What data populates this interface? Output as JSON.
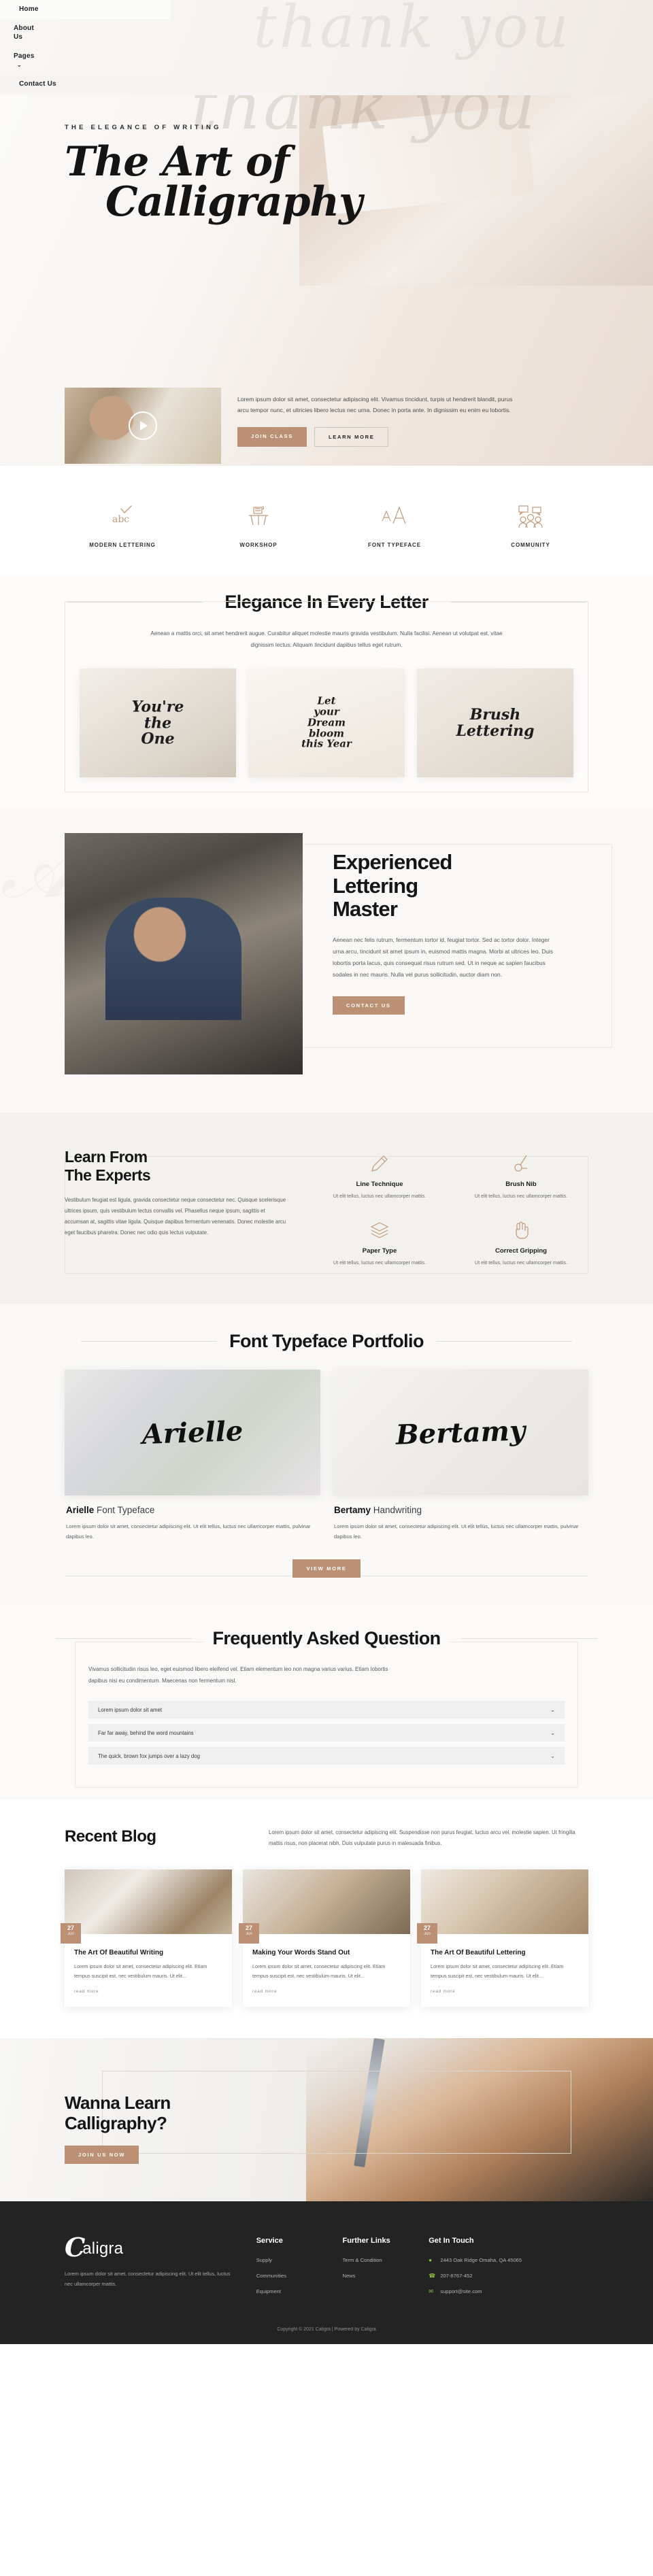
{
  "nav": {
    "items": [
      {
        "label": "Home",
        "caret": false
      },
      {
        "label": "About Us",
        "caret": false
      },
      {
        "label": "Pages",
        "caret": true
      },
      {
        "label": "Contact Us",
        "caret": false
      }
    ],
    "caret_glyph": "⌄"
  },
  "hero": {
    "eyebrow": "THE ELEGANCE OF WRITING",
    "title_line1": "The Art of",
    "title_line2": "Calligraphy",
    "bg_script": "thank you",
    "card": {
      "paragraph": "Lorem ipsum dolor sit amet, consectetur adipiscing elit. Vivamus tincidunt, turpis ut hendrerit blandit, purus arcu tempor nunc, et ultricies libero lectus nec urna. Donec in porta ante. In dignissim eu enim eu lobortis.",
      "primary_button": "JOIN CLASS",
      "secondary_button": "LEARN MORE",
      "play_icon": "play-icon"
    }
  },
  "features": [
    {
      "label": "MODERN LETTERING",
      "icon": "abc-check-icon"
    },
    {
      "label": "WORKSHOP",
      "icon": "workshop-desk-icon"
    },
    {
      "label": "FONT TYPEFACE",
      "icon": "font-aa-icon"
    },
    {
      "label": "COMMUNITY",
      "icon": "community-people-icon"
    }
  ],
  "elegance": {
    "title": "Elegance In Every Letter",
    "paragraph": "Aenean a mattis orci, sit amet hendrerit augue. Curabitur aliquet molestie mauris gravida vestibulum. Nulla facilisi. Aenean ut volutpat est, vitae dignissim lectus. Aliquam tincidunt dapibus tellus eget rutrum.",
    "cards": [
      {
        "line1": "You're",
        "line2": "the",
        "line3": "One"
      },
      {
        "line1": "Let",
        "line2": "your",
        "line3": "Dream",
        "line4": "bloom",
        "line5": "this Year"
      },
      {
        "line1": "Brush",
        "line2": "Lettering"
      }
    ]
  },
  "master": {
    "title_line1": "Experienced",
    "title_line2": "Lettering",
    "title_line3": "Master",
    "paragraph": "Aenean nec felis rutrum, fermentum tortor id, feugiat tortor. Sed ac tortor dolor. Integer urna arcu, tincidunt sit amet ipsum in, euismod mattis magna. Morbi at ultrices leo. Duis lobortis porta lacus, quis consequat risus rutrum sed. Ut in neque ac sapien faucibus sodales in nec mauris. Nulla vel purus sollicitudin, auctor diam non.",
    "button": "CONTACT US"
  },
  "experts": {
    "title_line1": "Learn From",
    "title_line2": "The Experts",
    "paragraph": "Vestibulum feugiat est ligula, gravida consectetur neque consectetur nec. Quisque scelerisque ultrices ipsum, quis vestibulum lectus convallis vel. Phasellus neque ipsum, sagittis et accumsan at, sagittis vitae ligula. Quisque dapibus fermentum venenatis. Donec molestie arcu eget faucibus pharetra. Donec nec odio quis lectus vulputate.",
    "items": [
      {
        "title": "Line Technique",
        "desc": "Ut elit tellus, luctus nec ullamcorper mattis.",
        "icon": "pencil-icon"
      },
      {
        "title": "Brush Nib",
        "desc": "Ut elit tellus, luctus nec ullamcorper mattis.",
        "icon": "brush-nib-icon"
      },
      {
        "title": "Paper Type",
        "desc": "Ut elit tellus, luctus nec ullamcorper mattis.",
        "icon": "layers-icon"
      },
      {
        "title": "Correct Gripping",
        "desc": "Ut elit tellus, luctus nec ullamcorper mattis.",
        "icon": "hand-icon"
      }
    ]
  },
  "portfolio": {
    "title": "Font Typeface Portfolio",
    "cards": [
      {
        "script": "Arielle",
        "name_bold": "Arielle",
        "name_rest": " Font Typeface",
        "desc": "Lorem ipsum dolor sit amet, consectetur adipiscing elit. Ut elit tellus, luctus nec ullamcorper mattis, pulvinar dapibus leo."
      },
      {
        "script": "Bertamy",
        "name_bold": "Bertamy",
        "name_rest": " Handwriting",
        "desc": "Lorem ipsum dolor sit amet, consectetur adipiscing elit. Ut elit tellus, luctus nec ullamcorper mattis, pulvinar dapibus leo."
      }
    ],
    "view_more": "VIEW MORE"
  },
  "faq": {
    "title": "Frequently Asked Question",
    "paragraph": "Vivamus sollicitudin risus leo, eget euismod libero eleifend vel. Etiam elementum leo non magna varius varius. Etiam lobortis dapibus nisi eu condimentum. Maecenas non fermentum nisl.",
    "chevron": "⌄",
    "items": [
      "Lorem ipsum dolor sit amet",
      "Far far away, behind the word mountains",
      "The quick, brown fox jumps over a lazy dog"
    ]
  },
  "blog": {
    "title": "Recent Blog",
    "paragraph": "Lorem ipsum dolor sit amet, consectetur adipiscing elit. Suspendisse non purus feugiat, luctus arcu vel, molestie sapien. Ut fringilla mattis risus, non placerat nibh. Duis vulputate purus in malesuada finibus.",
    "posts": [
      {
        "day": "27",
        "month": "Jun",
        "title": "The Art Of Beautiful Writing",
        "excerpt": "Lorem ipsum dolor sit amet, consectetur adipiscing elit. Etiam tempus suscipit est, nec vestibulum mauris. Ut elit...",
        "link": "read more"
      },
      {
        "day": "27",
        "month": "Jun",
        "title": "Making Your Words Stand Out",
        "excerpt": "Lorem ipsum dolor sit amet, consectetur adipiscing elit. Etiam tempus suscipit est, nec vestibulum mauris. Ut elit...",
        "link": "read more"
      },
      {
        "day": "27",
        "month": "Jun",
        "title": "The Art Of Beautiful Lettering",
        "excerpt": "Lorem ipsum dolor sit amet, consectetur adipiscing elit. Etiam tempus suscipit est, nec vestibulum mauris. Ut elit...",
        "link": "read more"
      }
    ]
  },
  "cta": {
    "title_line1": "Wanna Learn",
    "title_line2": "Calligraphy?",
    "button": "JOIN US NOW"
  },
  "footer": {
    "logo_mark": "C",
    "logo_word": "aligra",
    "about": "Lorem ipsum dolor sit amet, consectetur adipiscing elit. Ut elit tellus, luctus nec ullamcorper mattis.",
    "columns": [
      {
        "heading": "Service",
        "links": [
          "Supply",
          "Communities",
          "Equipment"
        ]
      },
      {
        "heading": "Further Links",
        "links": [
          "Term & Condition",
          "News"
        ]
      }
    ],
    "contact": {
      "heading": "Get In Touch",
      "address": "2443 Oak Ridge Omaha, QA 45065",
      "phone": "207-8767-452",
      "email": "support@site.com",
      "pin_icon": "location-pin-icon",
      "phone_icon": "phone-icon",
      "mail_icon": "envelope-icon"
    },
    "copyright": "Copyright © 2021 Caligra | Powered by Caligra"
  },
  "colors": {
    "accent": "#bc9074",
    "dark": "#232323",
    "green": "#8dc63f"
  }
}
